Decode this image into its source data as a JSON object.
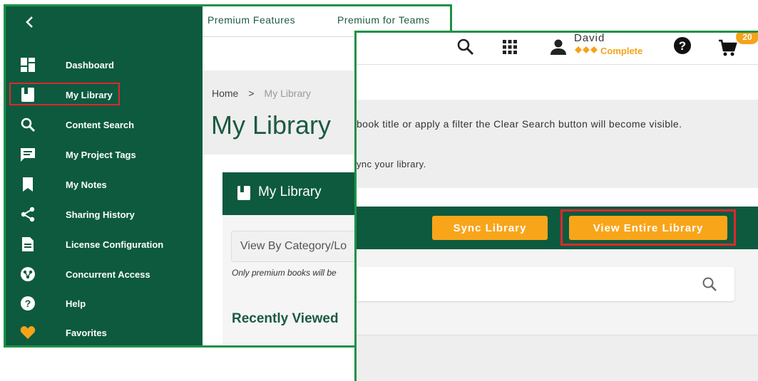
{
  "sidebar": {
    "items": [
      {
        "label": "Dashboard",
        "icon": "dashboard-icon"
      },
      {
        "label": "My Library",
        "icon": "book-icon"
      },
      {
        "label": "Content Search",
        "icon": "search-icon"
      },
      {
        "label": "My Project Tags",
        "icon": "message-icon"
      },
      {
        "label": "My Notes",
        "icon": "bookmark-icon"
      },
      {
        "label": "Sharing History",
        "icon": "share-icon"
      },
      {
        "label": "License Configuration",
        "icon": "document-icon"
      },
      {
        "label": "Concurrent Access",
        "icon": "network-icon"
      },
      {
        "label": "Help",
        "icon": "help-icon"
      },
      {
        "label": "Favorites",
        "icon": "heart-icon"
      }
    ],
    "selected": "My Library"
  },
  "topnav": {
    "links": [
      "Premium Features",
      "Premium for Teams"
    ]
  },
  "breadcrumb": {
    "home": "Home",
    "separator": ">",
    "current": "My Library"
  },
  "page": {
    "title": "My Library"
  },
  "library_card": {
    "title": "My Library",
    "category_placeholder": "View By Category/Lo",
    "premium_note": "Only premium books will be",
    "recent_title": "Recently Viewed"
  },
  "header2": {
    "user_name": "David",
    "user_status": "Complete",
    "cart_count": "20"
  },
  "info": {
    "line1": "book title or apply a filter the Clear Search button will become visible.",
    "line2": "ync your library."
  },
  "actions": {
    "sync_label": "Sync Library",
    "view_all_label": "View Entire Library"
  },
  "colors": {
    "primary_green": "#0d5a3f",
    "accent_orange": "#f9a51a",
    "highlight_red": "#e0282c",
    "frame_green": "#1e9146"
  }
}
